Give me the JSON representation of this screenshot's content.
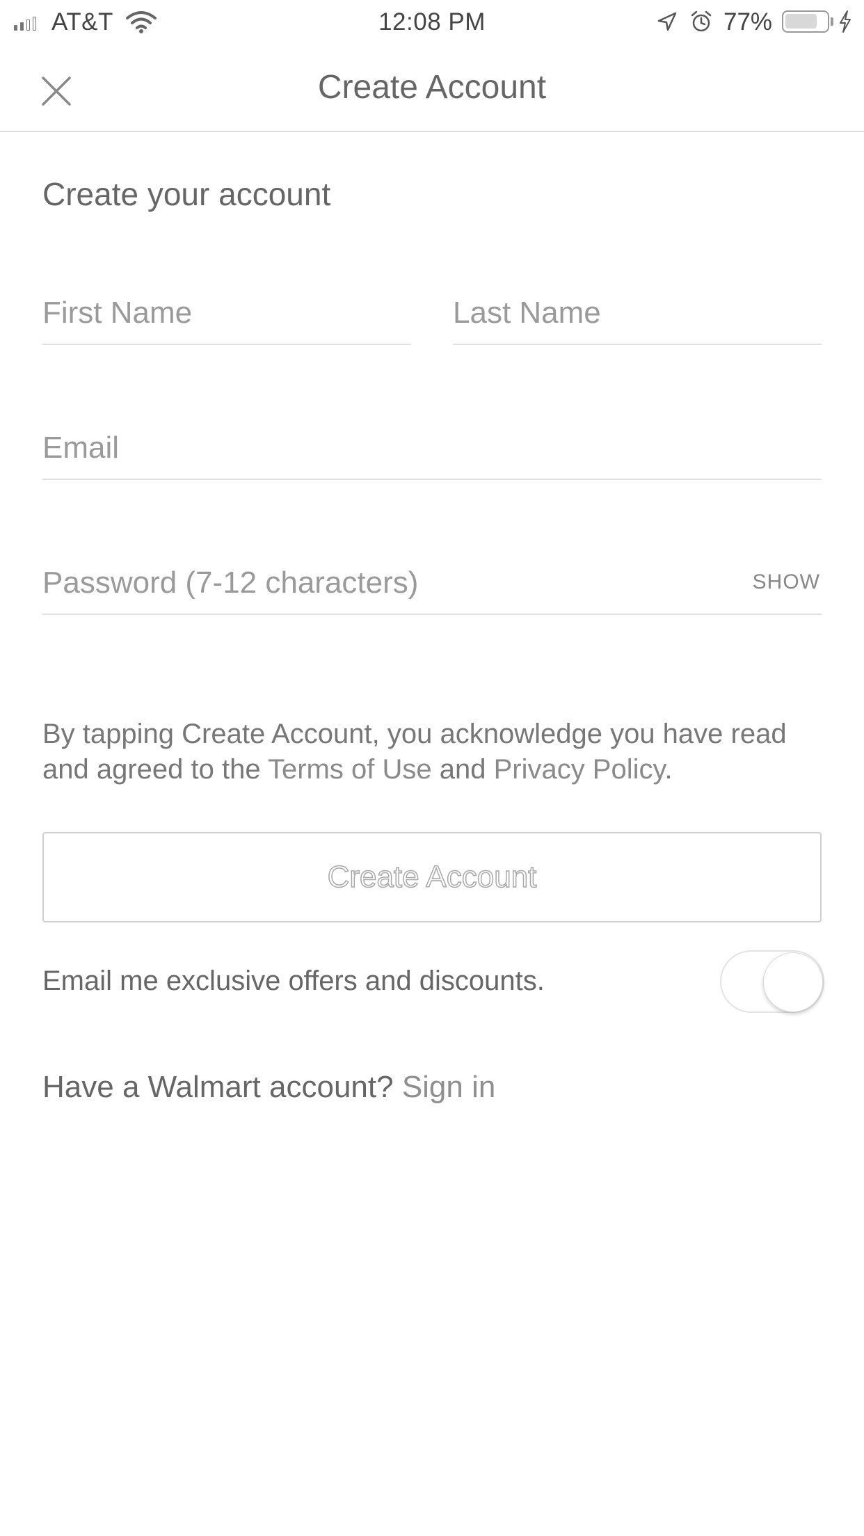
{
  "status_bar": {
    "carrier": "AT&T",
    "time": "12:08 PM",
    "battery_percent": "77%",
    "battery_level": 0.77,
    "signal_bars_on": 2,
    "signal_bars_total": 4,
    "icons": [
      "signal-icon",
      "wifi-icon",
      "location-arrow-icon",
      "alarm-icon",
      "battery-icon",
      "charging-bolt-icon"
    ]
  },
  "nav": {
    "title": "Create Account",
    "close_icon": "close-icon"
  },
  "form": {
    "heading": "Create your account",
    "first_name": {
      "placeholder": "First Name",
      "value": ""
    },
    "last_name": {
      "placeholder": "Last Name",
      "value": ""
    },
    "email": {
      "placeholder": "Email",
      "value": ""
    },
    "password": {
      "placeholder": "Password (7-12 characters)",
      "value": "",
      "show_label": "SHOW"
    }
  },
  "terms": {
    "prefix": "By tapping Create Account, you acknowledge you have read and agreed to the ",
    "terms_link": "Terms of Use",
    "and": " and ",
    "privacy_link": "Privacy Policy",
    "suffix": "."
  },
  "create_button": {
    "label": "Create Account"
  },
  "offers": {
    "label": "Email me exclusive offers and discounts.",
    "toggle_on": false
  },
  "signin": {
    "prompt": "Have a Walmart account? ",
    "link": "Sign in"
  },
  "colors": {
    "text": "#666666",
    "placeholder": "#9a9a9a",
    "divider": "#e0e0e0",
    "background": "#ffffff"
  }
}
